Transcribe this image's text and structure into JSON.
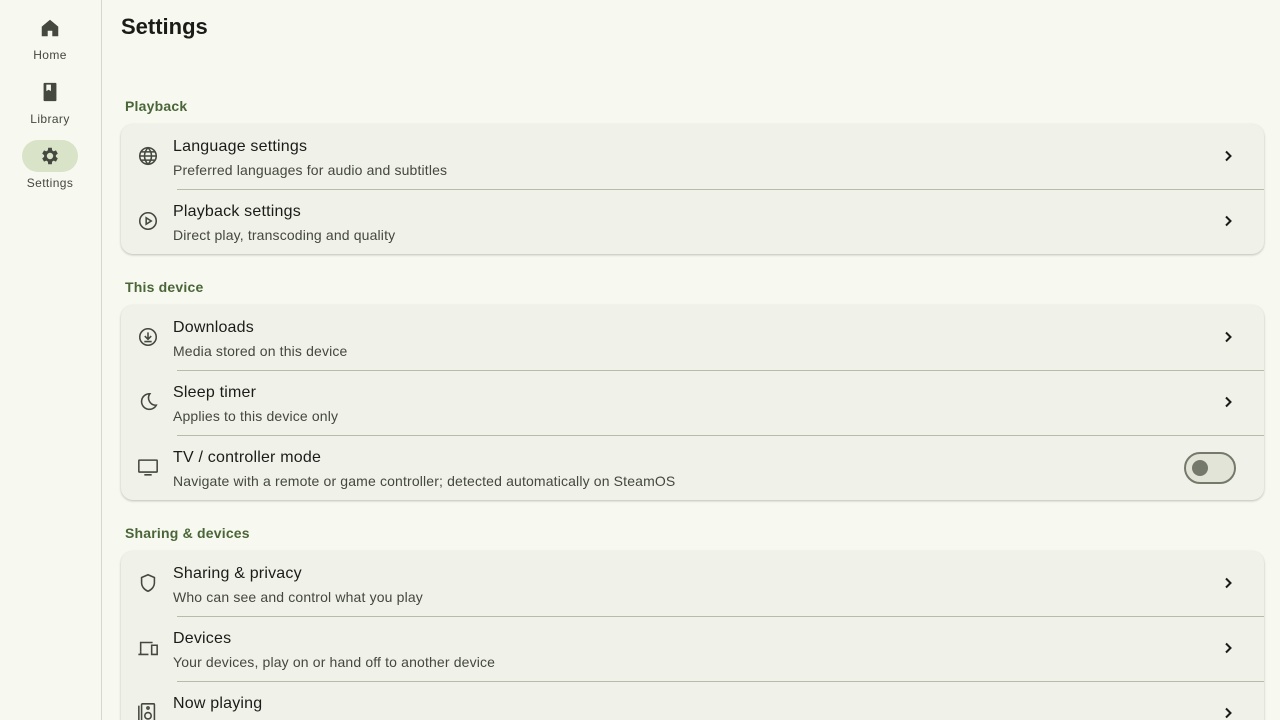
{
  "nav": {
    "items": [
      {
        "label": "Home",
        "icon": "home-icon",
        "active": false
      },
      {
        "label": "Library",
        "icon": "book-icon",
        "active": false
      },
      {
        "label": "Settings",
        "icon": "gear-icon",
        "active": true
      }
    ]
  },
  "page": {
    "title": "Settings"
  },
  "sections": [
    {
      "header": "Playback",
      "items": [
        {
          "title": "Language settings",
          "subtitle": "Preferred languages for audio and subtitles",
          "icon": "globe-icon"
        },
        {
          "title": "Playback settings",
          "subtitle": "Direct play, transcoding and quality",
          "icon": "play-circle-icon"
        }
      ]
    },
    {
      "header": "This device",
      "items": [
        {
          "title": "Downloads",
          "subtitle": "Media stored on this device",
          "icon": "download-icon"
        },
        {
          "title": "Sleep timer",
          "subtitle": "Applies to this device only",
          "icon": "moon-icon"
        },
        {
          "title": "TV / controller mode",
          "subtitle": "Navigate with a remote or game controller; detected automatically on SteamOS",
          "icon": "tv-icon",
          "toggle": false
        }
      ]
    },
    {
      "header": "Sharing & devices",
      "items": [
        {
          "title": "Sharing & privacy",
          "subtitle": "Who can see and control what you play",
          "icon": "shield-icon"
        },
        {
          "title": "Devices",
          "subtitle": "Your devices, play on or hand off to another device",
          "icon": "devices-icon"
        },
        {
          "title": "Now playing",
          "subtitle": "",
          "icon": "speaker-icon"
        }
      ]
    }
  ],
  "colors": {
    "background": "#f7f8f0",
    "card": "#f0f1e8",
    "accent": "#4a6638",
    "active_pill": "#d9e3c8"
  }
}
